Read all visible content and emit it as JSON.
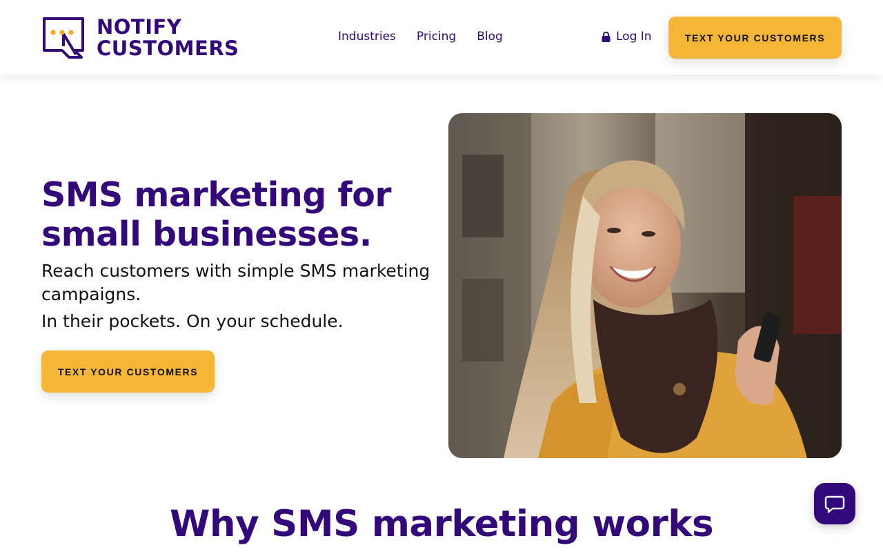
{
  "brand": {
    "line1": "NOTIFY",
    "line2": "CUSTOMERS",
    "icon": "chat-bubble-logo-icon",
    "primary_color": "#32087a",
    "accent_color": "#f5b638"
  },
  "nav": {
    "items": [
      {
        "label": "Industries"
      },
      {
        "label": "Pricing"
      },
      {
        "label": "Blog"
      }
    ],
    "login_label": "Log In",
    "login_icon": "lock-icon",
    "cta_label": "TEXT YOUR CUSTOMERS"
  },
  "hero": {
    "title": "SMS marketing for small businesses.",
    "subtitle1": "Reach customers with simple SMS marketing campaigns.",
    "subtitle2": "In their pockets. On your schedule.",
    "cta_label": "TEXT YOUR CUSTOMERS"
  },
  "section": {
    "title": "Why SMS marketing works"
  },
  "chat_widget": {
    "icon": "chat-bubble-icon"
  }
}
